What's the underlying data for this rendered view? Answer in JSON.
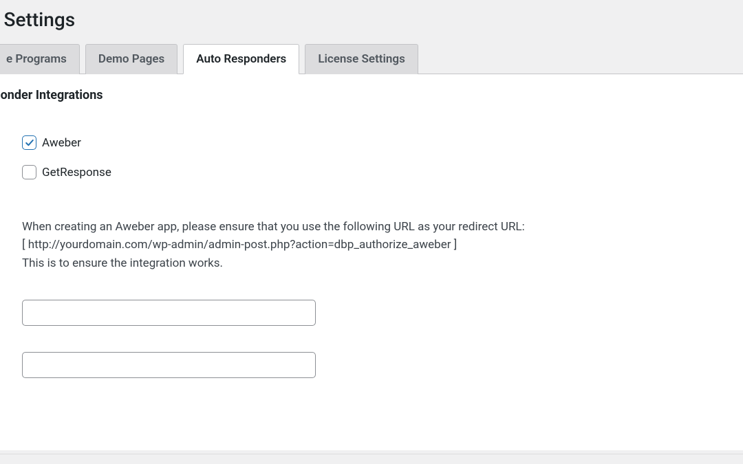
{
  "header": {
    "page_title": "gin Settings"
  },
  "tabs": {
    "items": [
      {
        "label": "e Programs",
        "active": false
      },
      {
        "label": "Demo Pages",
        "active": false
      },
      {
        "label": "Auto Responders",
        "active": true
      },
      {
        "label": "License Settings",
        "active": false
      }
    ]
  },
  "section": {
    "title": "Responder Integrations"
  },
  "checkboxes": {
    "aweber": {
      "label": "Aweber",
      "checked": true
    },
    "getresponse": {
      "label": "GetResponse",
      "checked": false
    }
  },
  "description": {
    "line1": "When creating an Aweber app, please ensure that you use the following URL as your redirect URL:",
    "line2": "[ http://yourdomain.com/wp-admin/admin-post.php?action=dbp_authorize_aweber ]",
    "line3": "This is to ensure the integration works."
  },
  "inputs": {
    "field1": {
      "value": "",
      "placeholder": ""
    },
    "field2": {
      "value": "",
      "placeholder": ""
    }
  }
}
